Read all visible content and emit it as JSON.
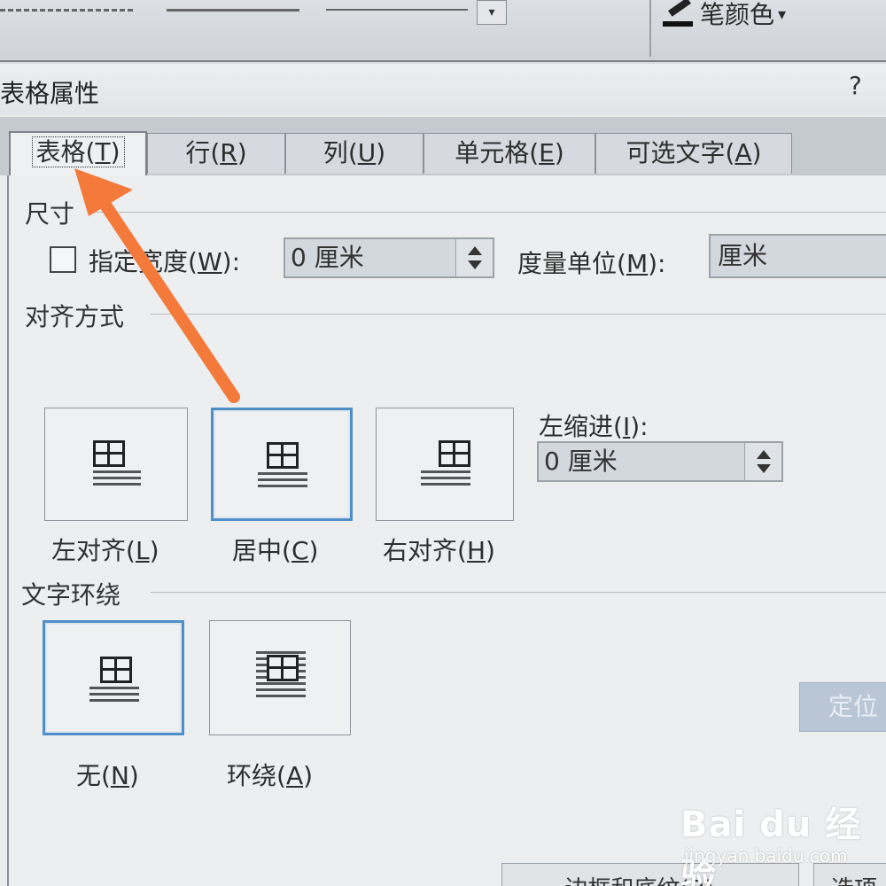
{
  "toolbar": {
    "pen_color_label": "笔颜色",
    "pen_color_chevron": "▾",
    "dropdown_chevron": "▾",
    "icons": [
      "border-style-icon",
      "dropdown-chevron-icon",
      "pen-icon"
    ]
  },
  "dialog": {
    "title": "表格属性",
    "help": "?"
  },
  "tabs": [
    {
      "label": "表格",
      "key": "T",
      "active": true
    },
    {
      "label": "行",
      "key": "R",
      "active": false
    },
    {
      "label": "列",
      "key": "U",
      "active": false
    },
    {
      "label": "单元格",
      "key": "E",
      "active": false
    },
    {
      "label": "可选文字",
      "key": "A",
      "active": false
    }
  ],
  "size": {
    "group_label": "尺寸",
    "specify_width_label": "指定宽度",
    "specify_width_key": "W",
    "specify_width_checked": false,
    "width_value": "0 厘米",
    "unit_label": "度量单位",
    "unit_key": "M",
    "unit_value": "厘米"
  },
  "alignment": {
    "group_label": "对齐方式",
    "options": [
      {
        "label": "左对齐",
        "key": "L",
        "selected": false
      },
      {
        "label": "居中",
        "key": "C",
        "selected": true
      },
      {
        "label": "右对齐",
        "key": "H",
        "selected": false
      }
    ],
    "indent_label": "左缩进",
    "indent_key": "I",
    "indent_value": "0 厘米"
  },
  "wrapping": {
    "group_label": "文字环绕",
    "options": [
      {
        "label": "无",
        "key": "N",
        "selected": true
      },
      {
        "label": "环绕",
        "key": "A",
        "selected": false
      }
    ],
    "position_button": "定位"
  },
  "bottom_buttons": {
    "borders_label": "边框和底纹",
    "borders_key": "B",
    "options_label": "选项"
  },
  "watermark": {
    "brand": "Bai du 经验",
    "site": "jingyan.baidu.com"
  },
  "colors": {
    "accent_selected": "#4f8fc8",
    "arrow": "#f47a3c",
    "tab_strip": "#c5cad1",
    "panel_bg": "#eceeef"
  }
}
